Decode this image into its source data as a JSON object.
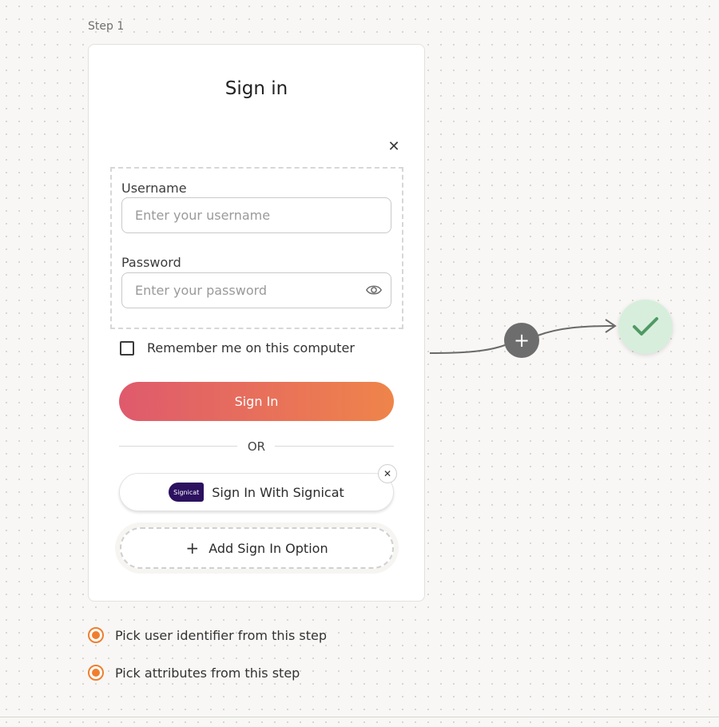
{
  "step_label": "Step 1",
  "card": {
    "title": "Sign in",
    "username": {
      "label": "Username",
      "placeholder": "Enter your username",
      "value": ""
    },
    "password": {
      "label": "Password",
      "placeholder": "Enter your password",
      "value": ""
    },
    "remember_label": "Remember me on this computer",
    "signin_label": "Sign In",
    "or_label": "OR",
    "signicat": {
      "logo_text": "Signicat",
      "label": "Sign In With Signicat"
    },
    "add_option_label": "Add Sign In Option"
  },
  "options": [
    {
      "label": "Pick user identifier from this step",
      "selected": true
    },
    {
      "label": "Pick attributes from this step",
      "selected": true
    }
  ],
  "colors": {
    "accent_orange": "#ef7f2e",
    "gradient_start": "#df5a6d",
    "gradient_end": "#ef844a",
    "success_green": "#4f9a63",
    "node_gray": "#6d6d6d",
    "signicat_purple": "#2c1160"
  },
  "icons": {
    "close": "close-icon",
    "eye": "eye-icon",
    "plus": "plus-icon",
    "check": "check-icon"
  }
}
